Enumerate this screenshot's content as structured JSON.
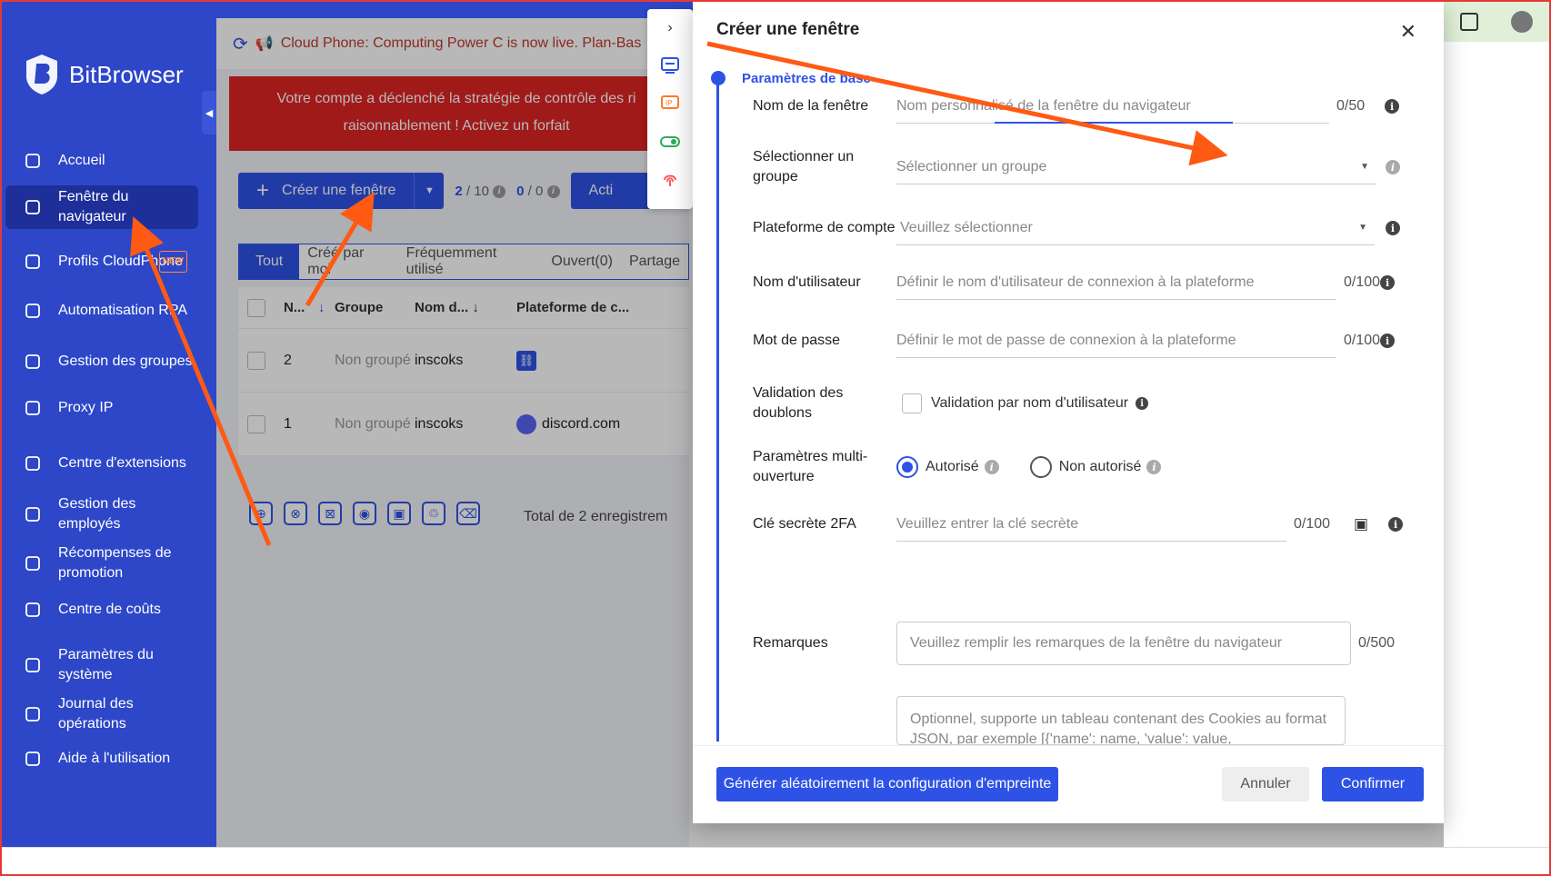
{
  "app": {
    "name": "BitBrowser"
  },
  "sidebar": {
    "items": [
      {
        "label": "Accueil",
        "icon": "home-icon"
      },
      {
        "label": "Fenêtre du navigateur",
        "icon": "grid-icon"
      },
      {
        "label": "Profils CloudPhone",
        "icon": "cloud-phone-icon",
        "badge": "NEW"
      },
      {
        "label": "Automatisation RPA",
        "icon": "robot-icon"
      },
      {
        "label": "Gestion des groupes",
        "icon": "layers-icon"
      },
      {
        "label": "Proxy IP",
        "icon": "location-icon"
      },
      {
        "label": "Centre d'extensions",
        "icon": "cube-icon"
      },
      {
        "label": "Gestion des employés",
        "icon": "users-icon"
      },
      {
        "label": "Récompenses de promotion",
        "icon": "dollar-icon"
      },
      {
        "label": "Centre de coûts",
        "icon": "yen-icon"
      },
      {
        "label": "Paramètres du système",
        "icon": "settings-icon"
      },
      {
        "label": "Journal des opérations",
        "icon": "log-icon"
      },
      {
        "label": "Aide à l'utilisation",
        "icon": "help-icon"
      }
    ]
  },
  "topbar": {
    "announcement": "Cloud Phone: Computing Power C is now live. Plan-Bas"
  },
  "warning": {
    "line1": "Votre compte a déclenché la stratégie de contrôle des ri",
    "line2": "raisonnablement ! Activez un forfait"
  },
  "toolbar": {
    "create_label": "Créer une fenêtre",
    "count1_used": "2",
    "count1_total": "/ 10",
    "count2_used": "0",
    "count2_total": "/ 0",
    "acti_label": "Acti"
  },
  "tabs": [
    "Tout",
    "Créé par moi",
    "Fréquemment utilisé",
    "Ouvert(0)",
    "Partage"
  ],
  "table": {
    "headers": {
      "no": "N...",
      "group": "Groupe",
      "name": "Nom d...",
      "platform": "Plateforme de c..."
    },
    "rows": [
      {
        "no": "2",
        "group": "Non groupé",
        "name": "inscoks",
        "platform": ""
      },
      {
        "no": "1",
        "group": "Non groupé",
        "name": "inscoks",
        "platform": "discord.com"
      }
    ],
    "total": "Total de 2 enregistrem"
  },
  "dialog": {
    "title": "Créer une fenêtre",
    "section": "Paramètres de base",
    "fields": {
      "window_name": {
        "label": "Nom de la fenêtre",
        "placeholder": "Nom personnalisé de la fenêtre du navigateur",
        "count": "0/50"
      },
      "group": {
        "label": "Sélectionner un groupe",
        "placeholder": "Sélectionner un groupe"
      },
      "platform": {
        "label": "Plateforme de compte",
        "placeholder": "Veuillez sélectionner"
      },
      "username": {
        "label": "Nom d'utilisateur",
        "placeholder": "Définir le nom d'utilisateur de connexion à la plateforme",
        "count": "0/100"
      },
      "password": {
        "label": "Mot de passe",
        "placeholder": "Définir le mot de passe de connexion à la plateforme",
        "count": "0/100"
      },
      "dedupe": {
        "label": "Validation des doublons",
        "option": "Validation par nom d'utilisateur"
      },
      "multi_open": {
        "label": "Paramètres multi-ouverture",
        "opt_yes": "Autorisé",
        "opt_no": "Non autorisé"
      },
      "secret_2fa": {
        "label": "Clé secrète 2FA",
        "placeholder": "Veuillez entrer la clé secrète",
        "count": "0/100"
      },
      "remarks": {
        "label": "Remarques",
        "placeholder": "Veuillez remplir les remarques de la fenêtre du navigateur",
        "count": "0/500"
      },
      "cookies": {
        "placeholder": "Optionnel, supporte un tableau contenant des Cookies au format JSON, par exemple [{'name': name, 'value': value,"
      }
    },
    "footer": {
      "random_label": "Générer aléatoirement la configuration d'empreinte",
      "cancel_label": "Annuler",
      "confirm_label": "Confirmer"
    }
  },
  "colors": {
    "accent": "#2e52e6",
    "sidebar": "#2d47c8",
    "warning": "#e02424",
    "arrow": "#ff5a14"
  }
}
